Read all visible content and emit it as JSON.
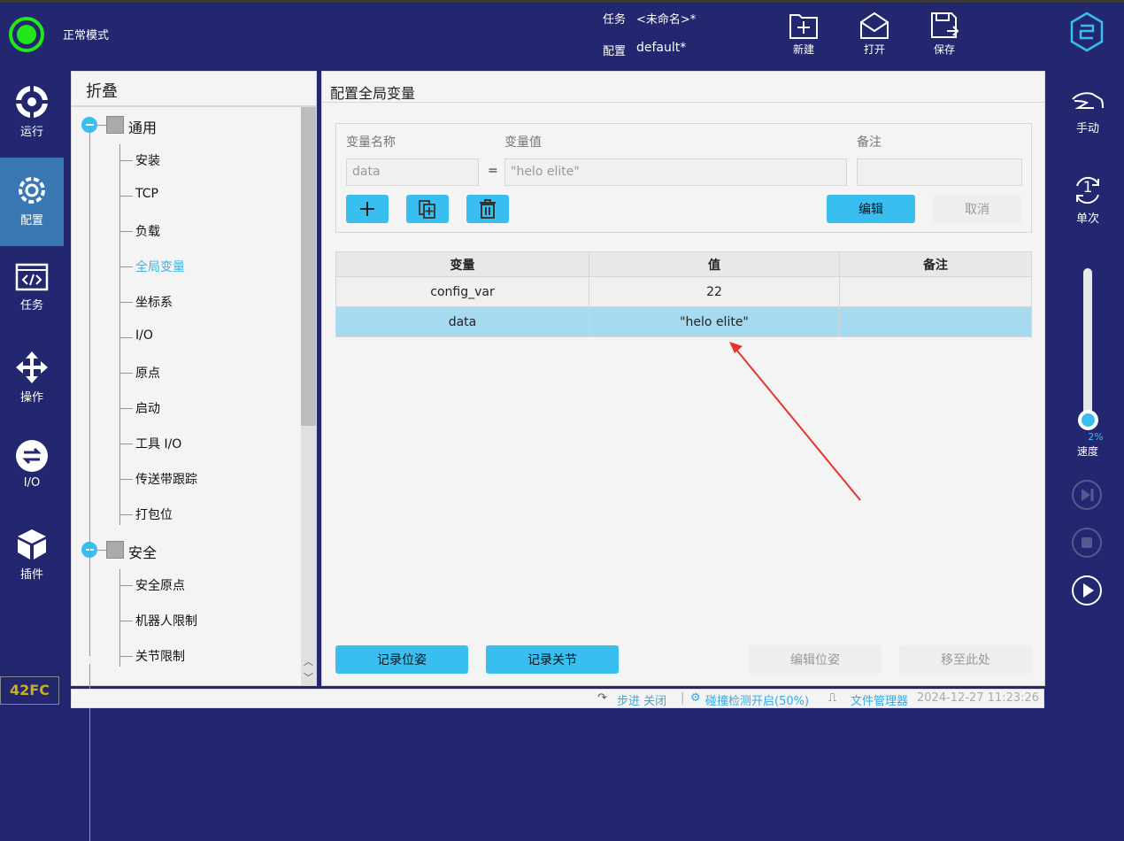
{
  "header": {
    "mode": "正常模式",
    "task_label": "任务",
    "task_value": "<未命名>*",
    "config_label": "配置",
    "config_value": "default*",
    "new": "新建",
    "open": "打开",
    "save": "保存",
    "status_color": "#22e81a"
  },
  "leftnav": [
    {
      "label": "运行",
      "icon": "run-icon"
    },
    {
      "label": "配置",
      "icon": "gear-icon"
    },
    {
      "label": "任务",
      "icon": "code-icon"
    },
    {
      "label": "操作",
      "icon": "move-icon"
    },
    {
      "label": "I/O",
      "icon": "io-icon"
    },
    {
      "label": "插件",
      "icon": "cube-icon"
    }
  ],
  "version": "42FC",
  "tree": {
    "header": "折叠",
    "groups": [
      {
        "label": "通用",
        "items": [
          "安装",
          "TCP",
          "负载",
          "全局变量",
          "坐标系",
          "I/O",
          "原点",
          "启动",
          "工具 I/O",
          "传送带跟踪",
          "打包位"
        ]
      },
      {
        "label": "安全",
        "items": [
          "安全原点",
          "机器人限制",
          "关节限制"
        ]
      }
    ],
    "active": "全局变量"
  },
  "main": {
    "title": "配置全局变量",
    "form": {
      "name_label": "变量名称",
      "value_label": "变量值",
      "note_label": "备注",
      "name_value": "data",
      "equals": "=",
      "value_value": "\"helo elite\"",
      "note_value": "",
      "edit": "编辑",
      "cancel": "取消"
    },
    "table": {
      "headers": [
        "变量",
        "值",
        "备注"
      ],
      "rows": [
        [
          "config_var",
          "22",
          ""
        ],
        [
          "data",
          "\"helo elite\"",
          ""
        ]
      ],
      "selected_row": 1
    },
    "buttons": {
      "record_pose": "记录位姿",
      "record_joint": "记录关节",
      "edit_pose": "编辑位姿",
      "move_here": "移至此处"
    }
  },
  "status": {
    "step": "步进 关闭",
    "collision": "碰撞检测开启(50%)",
    "files": "文件管理器",
    "datetime": "2024-12-27 11:23:26"
  },
  "rightbar": {
    "manual": "手动",
    "single": "单次",
    "single_num": "1",
    "speed_label": "速度",
    "speed_value": "2%",
    "speed_percent": 2
  },
  "colors": {
    "accent": "#38bff0",
    "nav_bg": "#23276f",
    "selected": "#3a78b5",
    "annotation_arrow": "#e8332a"
  }
}
